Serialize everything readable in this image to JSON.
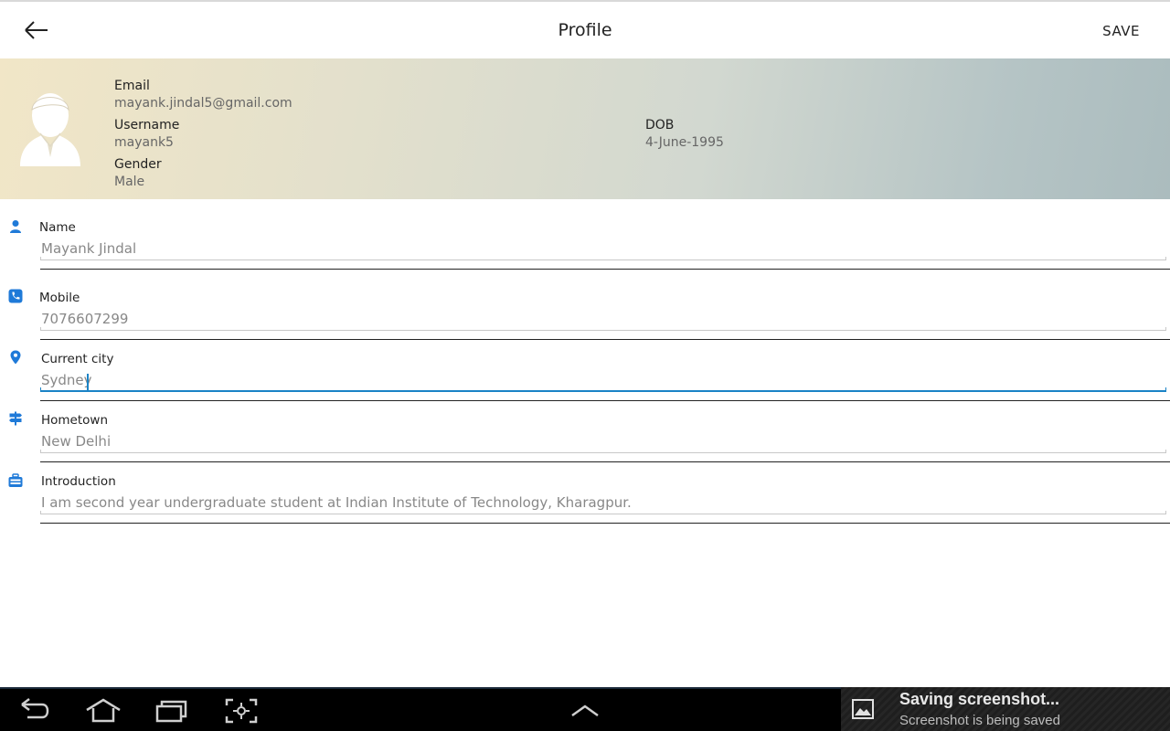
{
  "appbar": {
    "title": "Profile",
    "save_label": "SAVE"
  },
  "header": {
    "email": {
      "label": "Email",
      "value": "mayank.jindal5@gmail.com"
    },
    "username": {
      "label": "Username",
      "value": "mayank5"
    },
    "gender": {
      "label": "Gender",
      "value": "Male"
    },
    "dob": {
      "label": "DOB",
      "value": "4-June-1995"
    }
  },
  "form": {
    "name": {
      "label": "Name",
      "value": "Mayank Jindal",
      "icon": "person-icon"
    },
    "mobile": {
      "label": "Mobile",
      "value": "7076607299",
      "icon": "phone-icon"
    },
    "current_city": {
      "label": "Current city",
      "value": "Sydney",
      "icon": "location-pin-icon"
    },
    "hometown": {
      "label": "Hometown",
      "value": "New Delhi",
      "icon": "signpost-icon"
    },
    "introduction": {
      "label": "Introduction",
      "value": "I am second year undergraduate student at Indian Institute of Technology, Kharagpur.",
      "icon": "briefcase-icon"
    }
  },
  "toast": {
    "title": "Saving screenshot...",
    "subtitle": "Screenshot is being saved"
  },
  "colors": {
    "accent": "#1a83c6",
    "icon_blue": "#1f7ad8",
    "navbar": "#000000"
  }
}
